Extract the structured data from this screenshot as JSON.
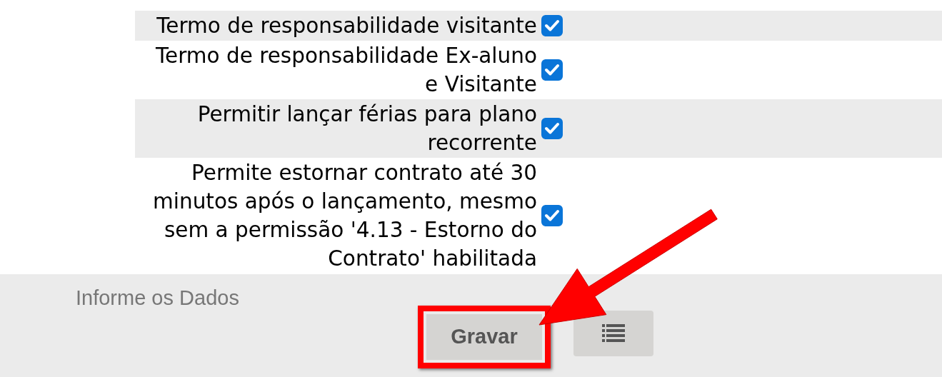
{
  "options": [
    {
      "label": "Termo de responsabilidade visitante",
      "checked": true
    },
    {
      "label": "Termo de responsabilidade Ex-aluno e Visitante",
      "checked": true
    },
    {
      "label": "Permitir lançar férias para plano recorrente",
      "checked": true
    },
    {
      "label": "Permite estornar contrato até 30 minutos após o lançamento, mesmo sem a permissão '4.13 - Estorno do Contrato' habilitada",
      "checked": true
    }
  ],
  "footer": {
    "title": "Informe os Dados",
    "save_button": "Gravar"
  }
}
